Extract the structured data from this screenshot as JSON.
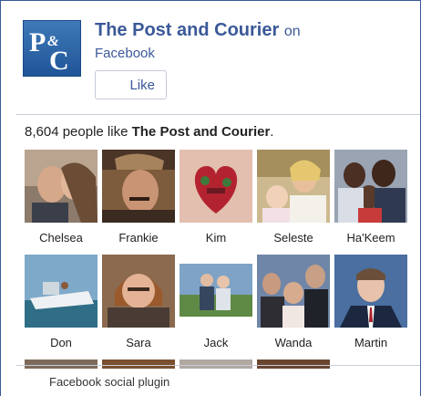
{
  "header": {
    "page_name": "The Post and Courier",
    "on_text": "on",
    "facebook_text": "Facebook",
    "like_label": "Like",
    "logo_text": "P&C"
  },
  "social": {
    "count": "8,604",
    "count_prefix": "people like",
    "page_name_bold": "The Post and Courier",
    "period": "."
  },
  "faces": [
    {
      "name": "Chelsea",
      "icon": "photo"
    },
    {
      "name": "Frankie",
      "icon": "photo"
    },
    {
      "name": "Kim",
      "icon": "photo"
    },
    {
      "name": "Seleste",
      "icon": "photo"
    },
    {
      "name": "Ha'Keem",
      "icon": "photo"
    },
    {
      "name": "Don",
      "icon": "photo"
    },
    {
      "name": "Sara",
      "icon": "photo"
    },
    {
      "name": "Jack",
      "icon": "photo"
    },
    {
      "name": "Wanda",
      "icon": "photo"
    },
    {
      "name": "Martin",
      "icon": "photo"
    }
  ],
  "footer": {
    "plugin_label": "Facebook social plugin"
  },
  "colors": {
    "brand": "#3b5998",
    "border": "#c7ccd7"
  }
}
